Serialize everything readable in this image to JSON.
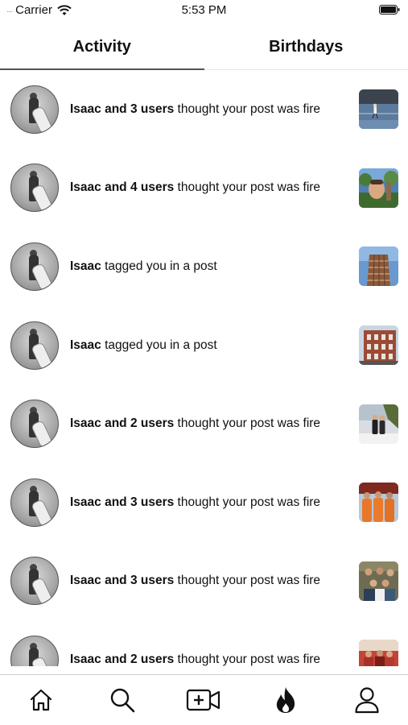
{
  "status_bar": {
    "signal": "....",
    "carrier": "Carrier",
    "time": "5:53 PM"
  },
  "tabs": [
    {
      "label": "Activity",
      "active": true
    },
    {
      "label": "Birthdays",
      "active": false
    }
  ],
  "notifications": [
    {
      "bold": "Isaac and 3 users",
      "rest": " thought your post was fire",
      "thumb": "tennis-court-photo"
    },
    {
      "bold": "Isaac and 4 users",
      "rest": " thought your post was fire",
      "thumb": "selfie-outdoor-photo"
    },
    {
      "bold": "Isaac",
      "rest": " tagged you in a post",
      "thumb": "vessel-building-photo"
    },
    {
      "bold": "Isaac",
      "rest": " tagged you in a post",
      "thumb": "brick-building-photo"
    },
    {
      "bold": "Isaac and 2 users",
      "rest": " thought your post was fire",
      "thumb": "couple-snow-photo"
    },
    {
      "bold": "Isaac and 3 users",
      "rest": " thought your post was fire",
      "thumb": "group-orange-shirts-photo"
    },
    {
      "bold": "Isaac and 3 users",
      "rest": " thought your post was fire",
      "thumb": "group-friends-photo"
    },
    {
      "bold": "Isaac and 2 users",
      "rest": " thought your post was fire",
      "thumb": "group-red-photo"
    }
  ],
  "bottom_nav": [
    {
      "icon": "home-icon"
    },
    {
      "icon": "search-icon"
    },
    {
      "icon": "add-video-icon"
    },
    {
      "icon": "fire-icon"
    },
    {
      "icon": "profile-icon"
    }
  ],
  "colors": {
    "text": "#111111",
    "tab_underline": "#555555",
    "divider": "#d0d0d0"
  }
}
